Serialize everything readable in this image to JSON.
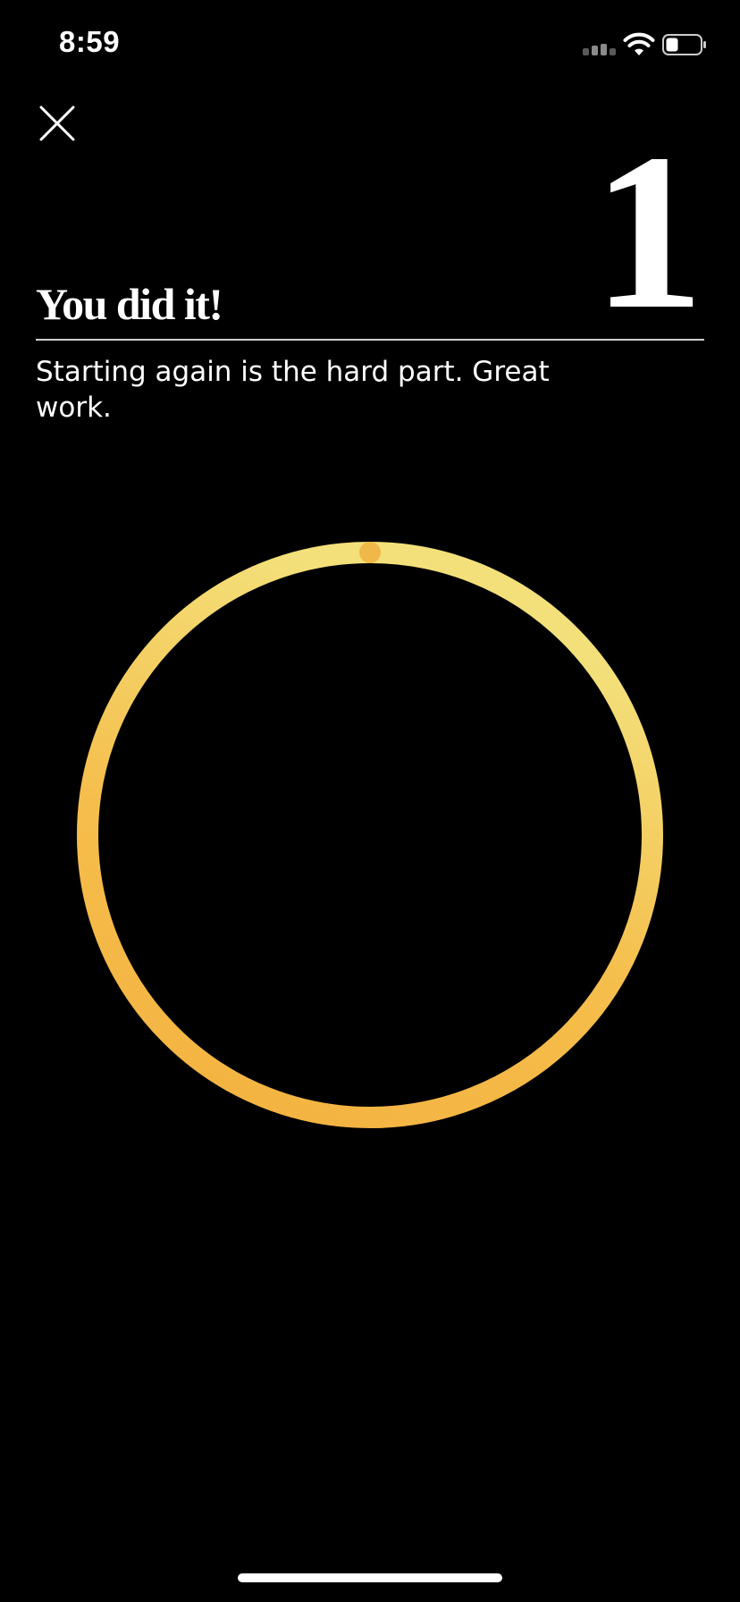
{
  "status_bar": {
    "time": "8:59",
    "icons": [
      "signal-icon",
      "wifi-icon",
      "battery-icon"
    ]
  },
  "close_button": {
    "icon": "close-icon"
  },
  "header": {
    "streak_number": "1",
    "title": "You did it!",
    "subtitle": "Starting again is the hard part. Great work."
  },
  "progress": {
    "fraction": 1.0
  },
  "colors": {
    "background": "#000000",
    "text": "#ffffff",
    "divider": "#cfcfcf",
    "ring_orange": "#F4B13F",
    "ring_yellow": "#F3E07A"
  }
}
